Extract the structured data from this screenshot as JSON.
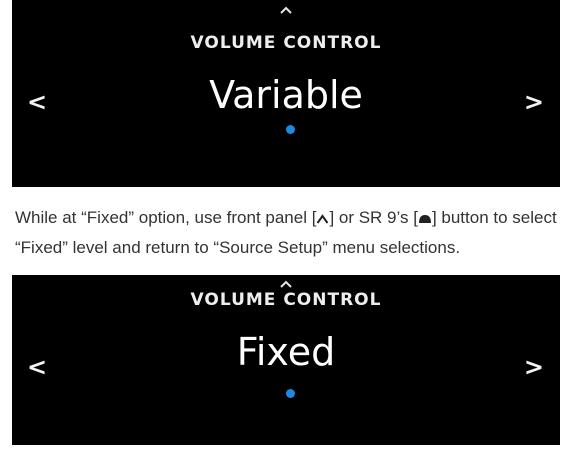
{
  "colors": {
    "screen_background": "#000000",
    "indicator_dot": "#1e88e5",
    "text_on_screen": "#ffffff",
    "body_text": "#333333"
  },
  "screens": [
    {
      "up_icon": "chevron-up-icon",
      "title": "VOLUME CONTROL",
      "value": "Variable",
      "left_arrow": "<",
      "right_arrow": ">"
    },
    {
      "up_icon": "chevron-up-icon",
      "title": "VOLUME CONTROL",
      "value": "Fixed",
      "left_arrow": "<",
      "right_arrow": ">"
    }
  ],
  "instruction": {
    "part1": "While at “Fixed” option, use front panel [",
    "part2": "] or SR 9’s [",
    "part3": "] button to select “Fixed” level and return to “Source Setup” menu selections.",
    "icon_front_panel": "up-caret-icon",
    "icon_remote": "remote-button-icon"
  }
}
